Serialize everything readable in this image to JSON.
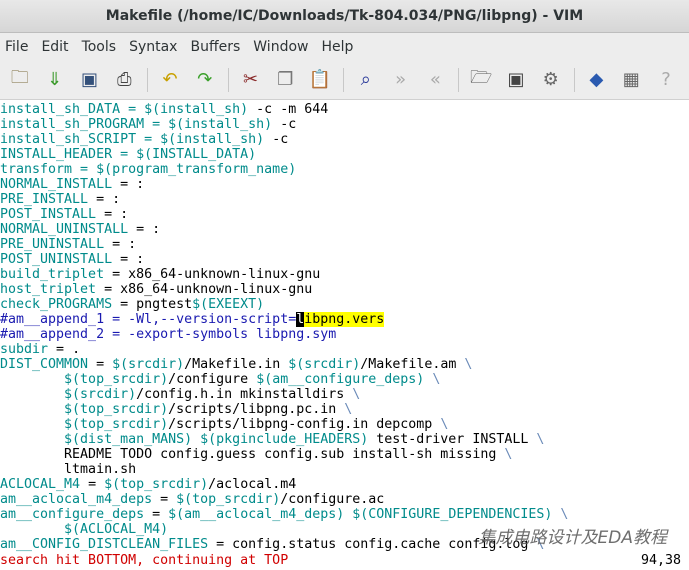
{
  "window": {
    "title": "Makefile (/home/IC/Downloads/Tk-804.034/PNG/libpng) - VIM"
  },
  "menu": [
    "File",
    "Edit",
    "Tools",
    "Syntax",
    "Buffers",
    "Window",
    "Help"
  ],
  "toolbar": [
    {
      "icon": "open-icon",
      "g": "🗀",
      "color": "#7a6a3a"
    },
    {
      "icon": "save-download-icon",
      "g": "⇓",
      "color": "#3a9a2a"
    },
    {
      "icon": "save-icon",
      "g": "▣",
      "color": "#33507a"
    },
    {
      "icon": "print-icon",
      "g": "⎙",
      "color": "#444"
    },
    {
      "sep": true
    },
    {
      "icon": "undo-icon",
      "g": "↶",
      "color": "#c8a000"
    },
    {
      "icon": "redo-icon",
      "g": "↷",
      "color": "#3aa02a"
    },
    {
      "sep": true
    },
    {
      "icon": "cut-icon",
      "g": "✂",
      "color": "#8a2a2a"
    },
    {
      "icon": "copy-icon",
      "g": "❐",
      "color": "#777"
    },
    {
      "icon": "paste-icon",
      "g": "📋",
      "color": "#a07a3a"
    },
    {
      "sep": true
    },
    {
      "icon": "find-replace-icon",
      "g": "⌕",
      "color": "#2a3a9a"
    },
    {
      "icon": "find-next-icon",
      "g": "»",
      "color": "#aaa"
    },
    {
      "icon": "find-prev-icon",
      "g": "«",
      "color": "#aaa"
    },
    {
      "sep": true
    },
    {
      "icon": "load-session-icon",
      "g": "🗁",
      "color": "#555"
    },
    {
      "icon": "save-session-icon",
      "g": "▣",
      "color": "#444"
    },
    {
      "icon": "run-script-icon",
      "g": "⚙",
      "color": "#666"
    },
    {
      "sep": true
    },
    {
      "icon": "make-icon",
      "g": "◆",
      "color": "#2a5ab0"
    },
    {
      "icon": "table-icon",
      "g": "▦",
      "color": "#666"
    },
    {
      "icon": "help-icon",
      "g": "?",
      "color": "#aaa"
    }
  ],
  "lines": [
    [
      [
        "install_sh_DATA = $(install_sh)",
        "v"
      ],
      [
        " -c -m 644",
        "n"
      ]
    ],
    [
      [
        "install_sh_PROGRAM = $(install_sh)",
        "v"
      ],
      [
        " -c",
        "n"
      ]
    ],
    [
      [
        "install_sh_SCRIPT = $(install_sh)",
        "v"
      ],
      [
        " -c",
        "n"
      ]
    ],
    [
      [
        "INSTALL_HEADER = $(INSTALL_DATA)",
        "v"
      ]
    ],
    [
      [
        "transform = $(program_transform_name)",
        "v"
      ]
    ],
    [
      [
        "NORMAL_INSTALL",
        "v"
      ],
      [
        " = :",
        "n"
      ]
    ],
    [
      [
        "PRE_INSTALL",
        "v"
      ],
      [
        " = :",
        "n"
      ]
    ],
    [
      [
        "POST_INSTALL",
        "v"
      ],
      [
        " = :",
        "n"
      ]
    ],
    [
      [
        "NORMAL_UNINSTALL",
        "v"
      ],
      [
        " = :",
        "n"
      ]
    ],
    [
      [
        "PRE_UNINSTALL",
        "v"
      ],
      [
        " = :",
        "n"
      ]
    ],
    [
      [
        "POST_UNINSTALL",
        "v"
      ],
      [
        " = :",
        "n"
      ]
    ],
    [
      [
        "build_triplet",
        "v"
      ],
      [
        " = x86_64-unknown-linux-gnu",
        "n"
      ]
    ],
    [
      [
        "host_triplet",
        "v"
      ],
      [
        " = x86_64-unknown-linux-gnu",
        "n"
      ]
    ],
    [
      [
        "check_PROGRAMS",
        "v"
      ],
      [
        " = pngtest",
        "n"
      ],
      [
        "$(EXEEXT)",
        "v"
      ]
    ],
    [
      [
        "#am__append_1 = -Wl,--version-script=",
        "c"
      ],
      [
        "l",
        "cur"
      ],
      [
        "ibpng.vers",
        "s"
      ]
    ],
    [
      [
        "#am__append_2 = -export-symbols libpng.sym",
        "c"
      ]
    ],
    [
      [
        "subdir",
        "v"
      ],
      [
        " = .",
        "n"
      ]
    ],
    [
      [
        "DIST_COMMON",
        "v"
      ],
      [
        " = ",
        "n"
      ],
      [
        "$(srcdir)",
        "v"
      ],
      [
        "/Makefile.in ",
        "n"
      ],
      [
        "$(srcdir)",
        "v"
      ],
      [
        "/Makefile.am ",
        "n"
      ],
      [
        "\\",
        "b"
      ]
    ],
    [
      [
        "        $(top_srcdir)",
        "v"
      ],
      [
        "/configure ",
        "n"
      ],
      [
        "$(am__configure_deps)",
        "v"
      ],
      [
        " \\",
        "b"
      ]
    ],
    [
      [
        "        $(srcdir)",
        "v"
      ],
      [
        "/config.h.in mkinstalldirs ",
        "n"
      ],
      [
        "\\",
        "b"
      ]
    ],
    [
      [
        "        $(top_srcdir)",
        "v"
      ],
      [
        "/scripts/libpng.pc.in ",
        "n"
      ],
      [
        "\\",
        "b"
      ]
    ],
    [
      [
        "        $(top_srcdir)",
        "v"
      ],
      [
        "/scripts/libpng-config.in depcomp ",
        "n"
      ],
      [
        "\\",
        "b"
      ]
    ],
    [
      [
        "        $(dist_man_MANS) $(pkginclude_HEADERS)",
        "v"
      ],
      [
        " test-driver INSTALL ",
        "n"
      ],
      [
        "\\",
        "b"
      ]
    ],
    [
      [
        "        README TODO config.guess config.sub install-sh missing ",
        "n"
      ],
      [
        "\\",
        "b"
      ]
    ],
    [
      [
        "        ltmain.sh",
        "n"
      ]
    ],
    [
      [
        "ACLOCAL_M4",
        "v"
      ],
      [
        " = ",
        "n"
      ],
      [
        "$(top_srcdir)",
        "v"
      ],
      [
        "/aclocal.m4",
        "n"
      ]
    ],
    [
      [
        "am__aclocal_m4_deps",
        "v"
      ],
      [
        " = ",
        "n"
      ],
      [
        "$(top_srcdir)",
        "v"
      ],
      [
        "/configure.ac",
        "n"
      ]
    ],
    [
      [
        "am__configure_deps",
        "v"
      ],
      [
        " = ",
        "n"
      ],
      [
        "$(am__aclocal_m4_deps) $(CONFIGURE_DEPENDENCIES)",
        "v"
      ],
      [
        " \\",
        "b"
      ]
    ],
    [
      [
        "        $(ACLOCAL_M4)",
        "v"
      ]
    ],
    [
      [
        "am__CONFIG_DISTCLEAN_FILES",
        "v"
      ],
      [
        " = config.status config.cache config.log ",
        "n"
      ],
      [
        "\\",
        "b"
      ]
    ]
  ],
  "status": {
    "message": "search hit BOTTOM, continuing at TOP",
    "position": "94,38"
  },
  "watermark": "集成电路设计及EDA教程"
}
